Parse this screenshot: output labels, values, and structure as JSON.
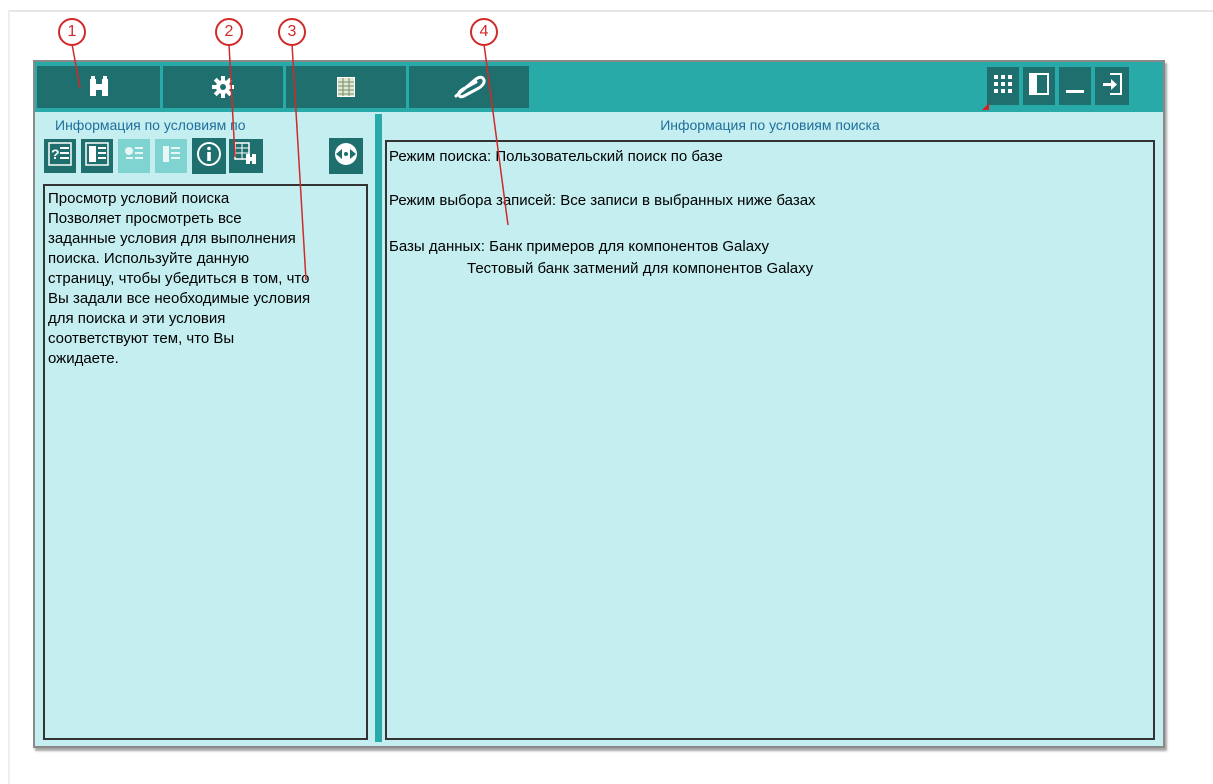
{
  "colors": {
    "toolbar": "#27aaa8",
    "button_dark": "#1f6f6e",
    "button_disabled": "#7fd4d1",
    "panel_background": "#c4eef0",
    "title_text": "#1f6f9c",
    "callout": "#d12a2a"
  },
  "callouts": [
    "1",
    "2",
    "3",
    "4"
  ],
  "toolbar": {
    "tabs": [
      {
        "icon": "binoculars-icon"
      },
      {
        "icon": "gear-icon"
      },
      {
        "icon": "grid-table-icon"
      },
      {
        "icon": "paperclip-icon"
      }
    ],
    "window_buttons": [
      {
        "icon": "grid-view-icon"
      },
      {
        "icon": "panel-layout-icon"
      },
      {
        "icon": "minimize-icon"
      },
      {
        "icon": "exit-icon"
      }
    ]
  },
  "left_panel": {
    "title": "Информация  по  условиям по",
    "buttons": [
      {
        "icon": "question-list-icon",
        "enabled": true
      },
      {
        "icon": "list-edit-icon",
        "enabled": true
      },
      {
        "icon": "list-add-icon",
        "enabled": false
      },
      {
        "icon": "list-remove-icon",
        "enabled": false
      },
      {
        "icon": "info-icon",
        "enabled": true
      },
      {
        "icon": "table-search-icon",
        "enabled": true
      },
      {
        "icon": "navigate-icon",
        "enabled": true
      }
    ],
    "help_text": "Просмотр условий поиска\nПозволяет просмотреть все\nзаданные условия для выполнения\nпоиска. Используйте данную\nстраницу, чтобы убедиться в том, что\nВы задали все необходимые условия\nдля поиска и эти условия\nсоответствуют тем, что Вы\nожидаете."
  },
  "right_panel": {
    "title": "Информация по условиям поиска",
    "search_mode": "Режим поиска: Пользовательский поиск по базе",
    "record_mode": "Режим выбора записей: Все записи в выбранных ниже базах",
    "databases_label": "Базы данных: Банк примеров для компонентов Galaxy",
    "databases_second": "Тестовый банк затмений для компонентов Galaxy"
  }
}
